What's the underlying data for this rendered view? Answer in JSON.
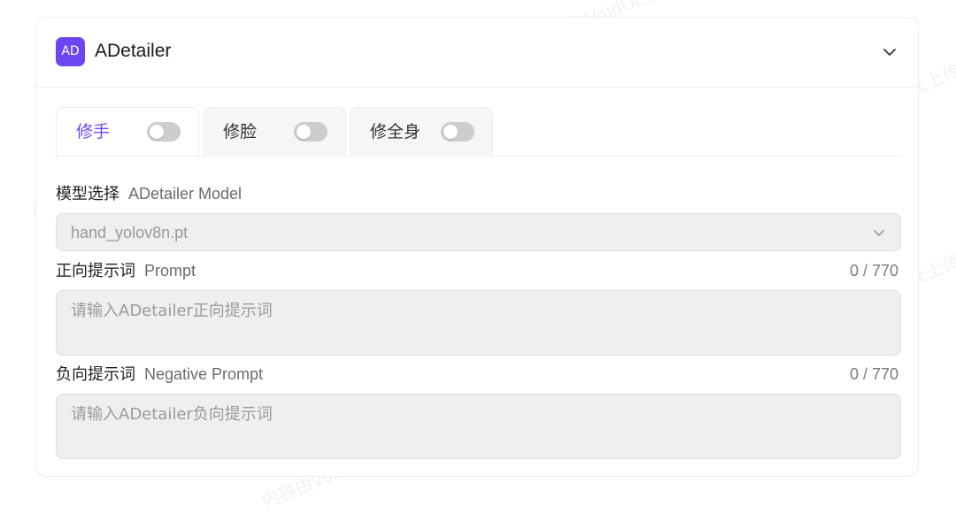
{
  "header": {
    "badge": "AD",
    "title": "ADetailer"
  },
  "tabs": [
    {
      "label": "修手",
      "active": true,
      "enabled": false
    },
    {
      "label": "修脸",
      "active": false,
      "enabled": false
    },
    {
      "label": "修全身",
      "active": false,
      "enabled": false
    }
  ],
  "model": {
    "label": "模型选择",
    "sublabel": "ADetailer Model",
    "value": "hand_yolov8n.pt"
  },
  "prompt": {
    "label": "正向提示词",
    "sublabel": "Prompt",
    "counter": "0 / 770",
    "placeholder": "请输入ADetailer正向提示词"
  },
  "negative_prompt": {
    "label": "负向提示词",
    "sublabel": "Negative Prompt",
    "counter": "0 / 770",
    "placeholder": "请输入ADetailer负向提示词"
  },
  "watermark": "内容由VoidOc上传",
  "colors": {
    "accent": "#6e46f1",
    "switch_off": "#cdcdcd",
    "field_bg": "#efefef"
  }
}
